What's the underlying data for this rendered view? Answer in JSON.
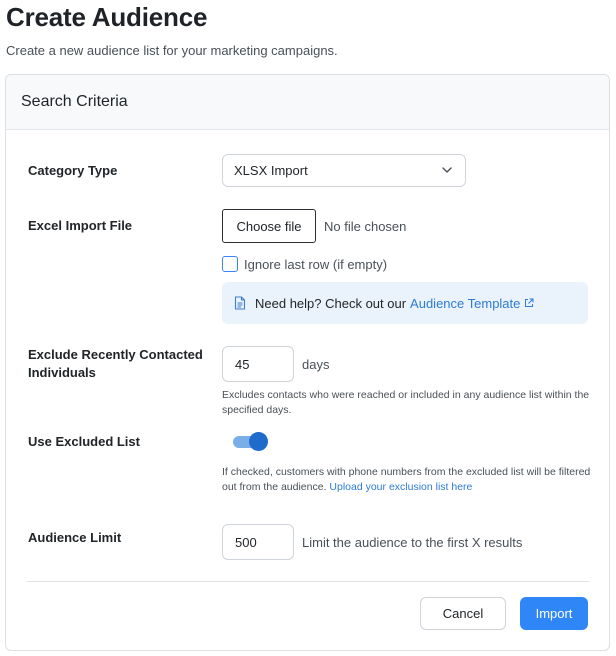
{
  "page": {
    "title": "Create Audience",
    "subtitle": "Create a new audience list for your marketing campaigns."
  },
  "card": {
    "title": "Search Criteria"
  },
  "form": {
    "category": {
      "label": "Category Type",
      "value": "XLSX Import"
    },
    "excel_file": {
      "label": "Excel Import File",
      "button_label": "Choose file",
      "status": "No file chosen"
    },
    "ignore_last_row": {
      "label": "Ignore last row (if empty)",
      "checked": false
    },
    "help": {
      "text": "Need help? Check out our",
      "link_text": "Audience Template"
    },
    "exclude_recent": {
      "label_line1": "Exclude Recently Contacted",
      "label_line2": "Individuals",
      "value": "45",
      "unit": "days",
      "hint": "Excludes contacts who were reached or included in any audience list within the specified days."
    },
    "excluded_list": {
      "label": "Use Excluded List",
      "enabled": true,
      "hint": "If checked, customers with phone numbers from the excluded list will be filtered out from the audience.",
      "link_text": "Upload your exclusion list here"
    },
    "audience_limit": {
      "label": "Audience Limit",
      "value": "500",
      "hint": "Limit the audience to the first X results"
    }
  },
  "actions": {
    "cancel_label": "Cancel",
    "import_label": "Import"
  },
  "colors": {
    "primary": "#2f86f6",
    "link": "#2e7bd3",
    "help_bg": "#eaf3fc",
    "toggle_on": "#1f6bcc"
  }
}
